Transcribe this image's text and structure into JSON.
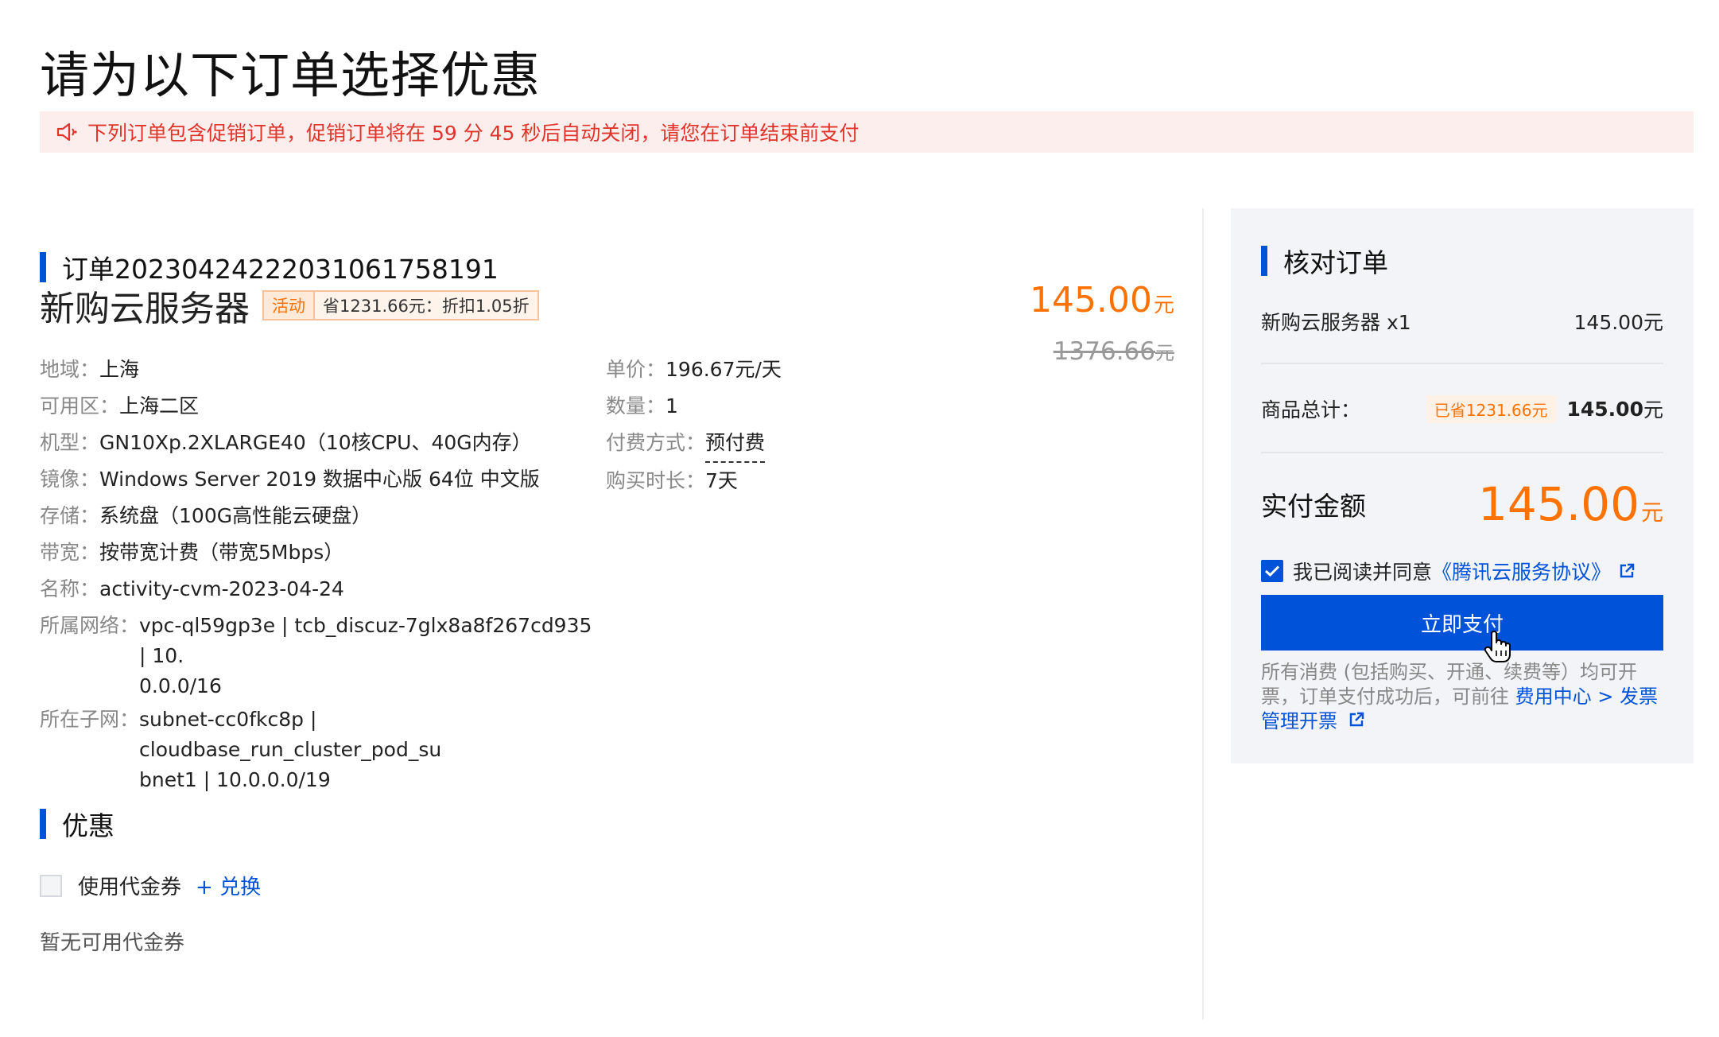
{
  "page": {
    "title": "请为以下订单选择优惠"
  },
  "notice": {
    "icon": "speaker-icon",
    "text": "下列订单包含促销订单，促销订单将在 59 分 45 秒后自动关闭，请您在订单结束前支付"
  },
  "order": {
    "id_label": "订单20230424222031061758191",
    "product_name": "新购云服务器",
    "activity_tag": "活动",
    "discount_tag": "省1231.66元：折扣1.05折",
    "price_now": "145.00",
    "price_now_unit": "元",
    "price_old": "1376.66",
    "price_old_unit": "元",
    "specs_left": [
      {
        "key": "地域：",
        "value": "上海"
      },
      {
        "key": "可用区：",
        "value": "上海二区"
      },
      {
        "key": "机型：",
        "value": "GN10Xp.2XLARGE40（10核CPU、40G内存）"
      },
      {
        "key": "镜像：",
        "value": "Windows Server 2019 数据中心版 64位 中文版"
      },
      {
        "key": "存储：",
        "value": "系统盘（100G高性能云硬盘）"
      },
      {
        "key": "带宽：",
        "value": "按带宽计费（带宽5Mbps）"
      },
      {
        "key": "名称：",
        "value": "activity-cvm-2023-04-24"
      },
      {
        "key": "所属网络：",
        "value_line1": "vpc-ql59gp3e | tcb_discuz-7glx8a8f267cd935 | 10.",
        "value_line2": "0.0.0/16"
      },
      {
        "key": "所在子网：",
        "value_line1": "subnet-cc0fkc8p | cloudbase_run_cluster_pod_su",
        "value_line2": "bnet1 | 10.0.0.0/19"
      }
    ],
    "specs_right": [
      {
        "key": "单价：",
        "value": "196.67元/天"
      },
      {
        "key": "数量：",
        "value": "1"
      },
      {
        "key": "付费方式：",
        "value": "预付费"
      },
      {
        "key": "购买时长：",
        "value": "7天"
      }
    ]
  },
  "discount": {
    "heading": "优惠",
    "use_voucher_label": "使用代金券",
    "redeem_label": "+ 兑换",
    "no_voucher_text": "暂无可用代金券"
  },
  "summary": {
    "heading": "核对订单",
    "item_label": "新购云服务器 x1",
    "item_price": "145.00元",
    "total_label": "商品总计：",
    "saved_badge": "已省1231.66元",
    "total_value": "145.00",
    "total_unit": "元",
    "pay_label": "实付金额",
    "pay_value": "145.00",
    "pay_unit": "元",
    "agree_prefix": "我已阅读并同意",
    "agree_link": "《腾讯云服务协议》",
    "agree_checked": true,
    "pay_button": "立即支付",
    "note_text": "所有消费 (包括购买、开通、续费等）均可开票，订单支付成功后，可前往 ",
    "note_link": "费用中心 > 发票管理开票"
  },
  "colors": {
    "accent": "#0052d9",
    "price": "#ff7200",
    "notice_text": "#e0342a",
    "notice_bg": "#fdeeee"
  }
}
